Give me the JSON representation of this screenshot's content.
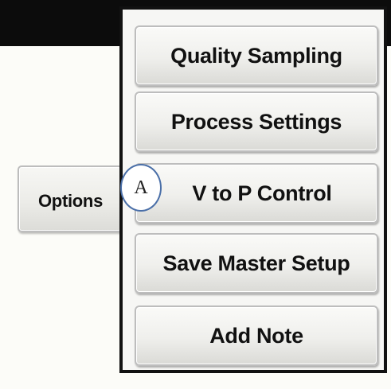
{
  "options_button": {
    "label": "Options"
  },
  "menu": {
    "items": [
      {
        "label": "Quality Sampling"
      },
      {
        "label": "Process Settings"
      },
      {
        "label": "V to P Control"
      },
      {
        "label": "Save Master Setup"
      },
      {
        "label": "Add Note"
      }
    ]
  },
  "annotation": {
    "marker_label": "A"
  },
  "colors": {
    "top_bar": "#0c0c0c",
    "panel_border": "#111111",
    "marker_border": "#4a6fa8"
  }
}
